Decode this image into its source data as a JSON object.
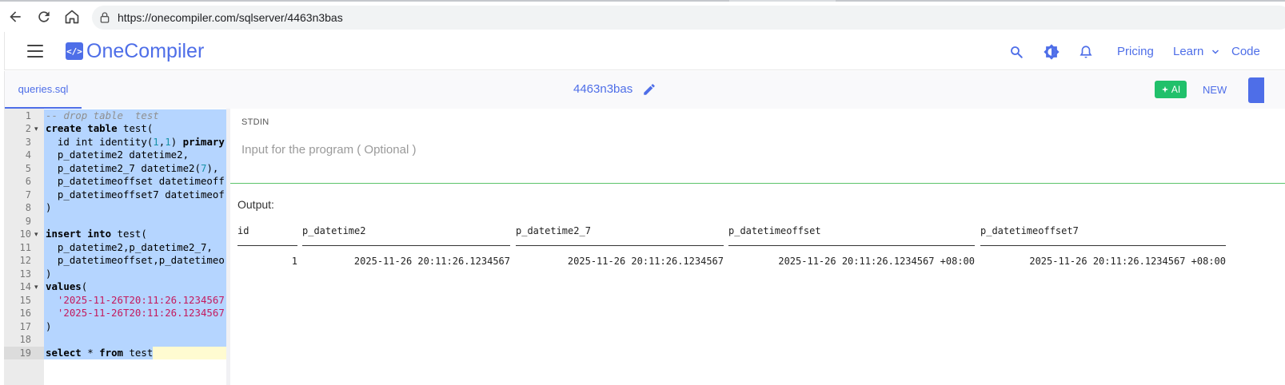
{
  "browser": {
    "url": "https://onecompiler.com/sqlserver/4463n3bas"
  },
  "header": {
    "logo_text": "OneCompiler",
    "logo_mark": "</>",
    "pricing_label": "Pricing",
    "learn_label": "Learn",
    "code_label": "Code",
    "icons": [
      "menu-icon",
      "search-icon",
      "theme-icon",
      "bell-icon",
      "chevron-down-icon"
    ]
  },
  "toolbar": {
    "file_tab": "queries.sql",
    "code_id": "4463n3bas",
    "ai_label": "AI",
    "new_label": "NEW"
  },
  "editor": {
    "line_numbers": [
      "1",
      "2",
      "3",
      "4",
      "5",
      "6",
      "7",
      "8",
      "9",
      "10",
      "11",
      "12",
      "13",
      "14",
      "15",
      "16",
      "17",
      "18",
      "19"
    ],
    "lines": [
      "-- drop table  test",
      "create table test(",
      "  id int identity(1,1) primary",
      "  p_datetime2 datetime2,",
      "  p_datetime2_7 datetime2(7),",
      "  p_datetimeoffset datetimeoff",
      "  p_datetimeoffset7 datetimeof",
      ")",
      "",
      "insert into test(",
      "  p_datetime2,p_datetime2_7,",
      "  p_datetimeoffset,p_datetimeo",
      ")",
      "values(",
      "  '2025-11-26T20:11:26.1234567",
      "  '2025-11-26T20:11:26.1234567",
      ")",
      "",
      "select * from test"
    ]
  },
  "stdin": {
    "label": "STDIN",
    "placeholder": "Input for the program ( Optional )"
  },
  "output": {
    "label": "Output:",
    "columns": [
      "id",
      "p_datetime2",
      "p_datetime2_7",
      "p_datetimeoffset",
      "p_datetimeoffset7"
    ],
    "rows": [
      [
        "1",
        "2025-11-26 20:11:26.1234567",
        "2025-11-26 20:11:26.1234567",
        "2025-11-26 20:11:26.1234567 +08:00",
        "2025-11-26 20:11:26.1234567 +08:00"
      ]
    ]
  },
  "colors": {
    "accent": "#4e6ee8",
    "ai_green": "#21c06b",
    "selection": "#b5d5ff",
    "stdin_divider": "#5cc46a"
  }
}
